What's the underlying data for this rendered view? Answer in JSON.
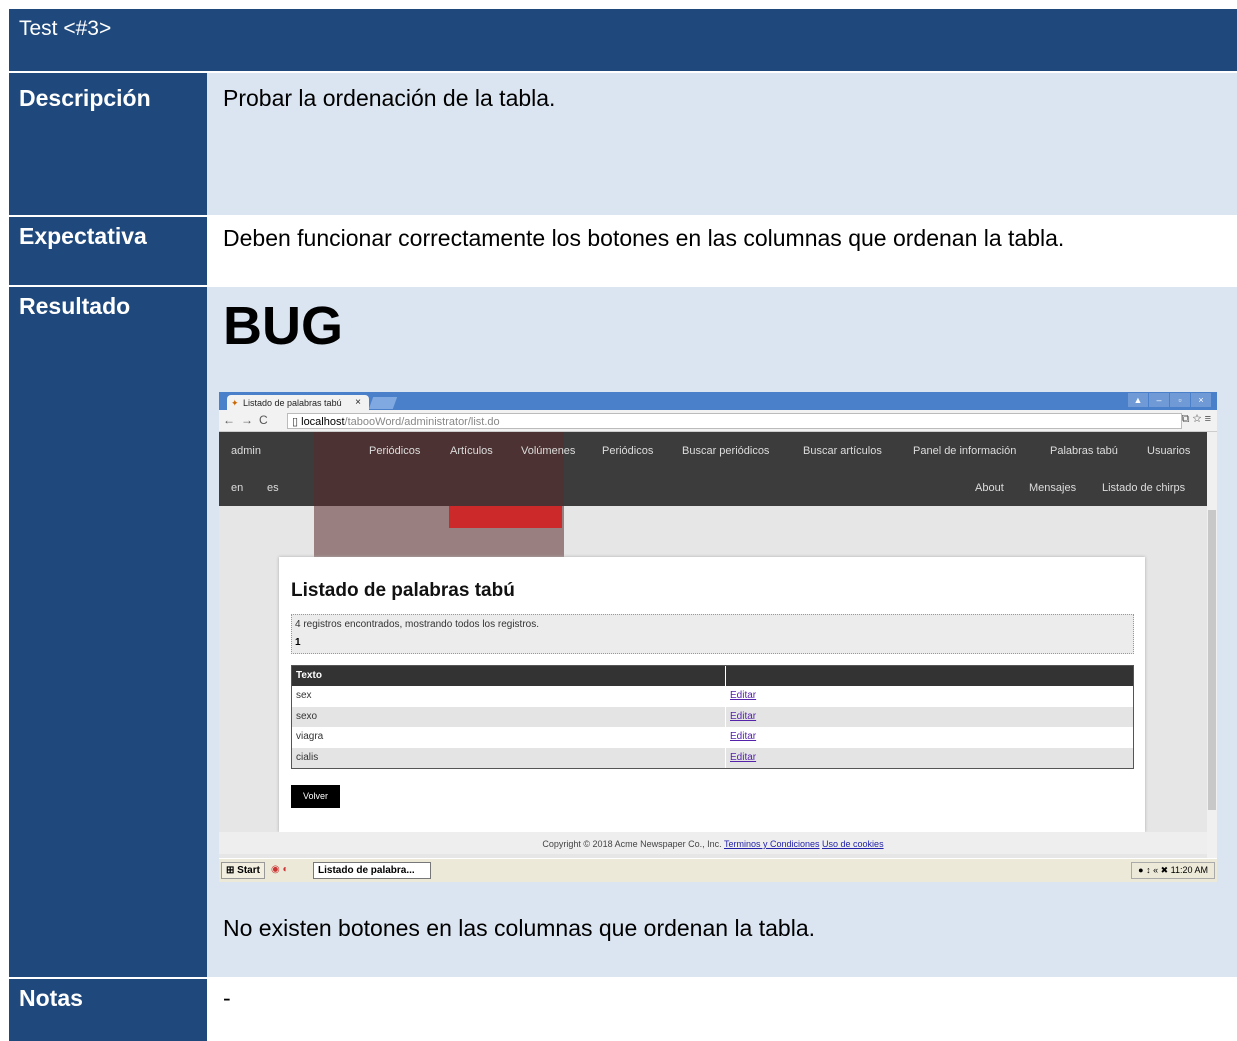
{
  "header": {
    "title": "Test <#3>"
  },
  "rows": {
    "descripcion": {
      "label": "Descripción",
      "text": "Probar la ordenación de la tabla."
    },
    "expectativa": {
      "label": "Expectativa",
      "text": "Deben funcionar correctamente los botones en las columnas que ordenan la tabla."
    },
    "resultado": {
      "label": "Resultado",
      "status": "BUG",
      "text": "No existen botones en las columnas que ordenan la tabla."
    },
    "notas": {
      "label": "Notas",
      "text": "-"
    }
  },
  "screenshot": {
    "tab_title": "Listado de palabras tabú",
    "tab_close": "×",
    "url_host": "localhost",
    "url_path": "/tabooWord/administrator/list.do",
    "menu_top": [
      "admin",
      "Periódicos",
      "Artículos",
      "Volúmenes",
      "Periódicos",
      "Buscar periódicos",
      "Buscar artículos",
      "Panel de información",
      "Palabras tabú",
      "Usuarios"
    ],
    "menu_bottom_left": [
      "en",
      "es"
    ],
    "menu_bottom_right": [
      "About",
      "Mensajes",
      "Listado de chirps"
    ],
    "page_heading": "Listado de palabras tabú",
    "records_info": "4 registros encontrados, mostrando todos los registros.",
    "page_number": "1",
    "table_header": "Texto",
    "table_rows": [
      {
        "text": "sex",
        "action": "Editar"
      },
      {
        "text": "sexo",
        "action": "Editar"
      },
      {
        "text": "viagra",
        "action": "Editar"
      },
      {
        "text": "cialis",
        "action": "Editar"
      }
    ],
    "back_button": "Volver",
    "footer_text": "Copyright © 2018 Acme Newspaper Co., Inc.",
    "footer_link1": "Terminos y Condiciones",
    "footer_link2": "Uso de cookies",
    "taskbar_start": "Start",
    "taskbar_item": "Listado de palabra...",
    "clock": "11:20 AM"
  }
}
